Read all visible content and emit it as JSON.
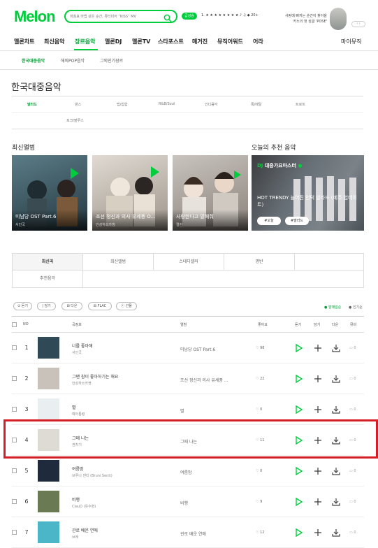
{
  "header": {
    "logo": "Melon",
    "search_placeholder": "마침표 마법 같은 순간, 뮤터미어 “KISS” MV",
    "badge": "급상승",
    "rank": "1. ★ ★ ★ ★ ★ ★ ★ ★ ♪ ♫ ◆ 20+",
    "promo_line1": "사랑에 빠지는 순간이 찾아올",
    "promo_line2": "카노의 첫 싱글 'POSE'",
    "arrows": "‹ ›"
  },
  "gnb": [
    "멜론차트",
    "최신음악",
    "장르음악",
    "멜론DJ",
    "멜론TV",
    "스타포스트",
    "매거진",
    "뮤직어워드",
    "어라",
    "마이뮤직"
  ],
  "subnav": [
    "한국대중음악",
    "해외POP음악",
    "그외인기장르"
  ],
  "page_title": "한국대중음악",
  "genres": [
    "발라드",
    "댄스",
    "랩/힙합",
    "R&B/Soul",
    "인디음악",
    "록/메탈",
    "트로트",
    "포크/블루스"
  ],
  "sections": {
    "latest_albums": "최신앨범",
    "today_rec": "오늘의 추천 음악"
  },
  "albums": [
    {
      "title": "미남당 OST Part.6",
      "artist": "서인국",
      "bg": "#2f4a56"
    },
    {
      "title": "조선 정신과 의사 유세풍 O...",
      "artist": "안성하쓰카쟁",
      "bg": "#c8c2bb"
    },
    {
      "title": "사랑한다고 말해줘",
      "artist": "컬린",
      "bg": "#a59e97"
    }
  ],
  "dj": {
    "head": "DJ",
    "name": "대중가요마스터",
    "body": "HOT TRENDY 늘어진 언덕 발라드 (예주 업데이트)",
    "tag1": "#오늘",
    "tag2": "#발라드"
  },
  "tabs": [
    "최신곡",
    "최신앨범",
    "스테디셀러",
    "명반",
    "추천음악"
  ],
  "action_buttons": [
    "⊙ 듣기",
    "| 담기",
    "⊞ 다운",
    "⊞ FLAC",
    "ⓣ 선물"
  ],
  "sort": {
    "latest": "● 발매일순",
    "popular": "● 인기순"
  },
  "table_headers": {
    "no": "NO",
    "song": "곡정보",
    "album": "앨범",
    "like": "좋아요",
    "play": "듣기",
    "add": "담기",
    "download": "다운",
    "mv": "뮤비"
  },
  "songs": [
    {
      "no": "1",
      "title": "너를 좋아해",
      "artist": "서인국",
      "album": "미남당 OST Part.6",
      "likes": "♡ 98",
      "mv": "▭ 0",
      "thumb": "#2f4a56"
    },
    {
      "no": "2",
      "title": "그땐 참이 좋아하기는 해요",
      "artist": "안성하쓰카쟁",
      "album": "조선 정신과 의사 유세풍 ...",
      "likes": "♡ 22",
      "mv": "▭ 0",
      "thumb": "#c8c2bb"
    },
    {
      "no": "3",
      "title": "별",
      "artist": "예아통령",
      "album": "별",
      "likes": "♡ 0",
      "mv": "▭ 0",
      "thumb": "#e9eef1"
    },
    {
      "no": "4",
      "title": "그때 나는",
      "artist": "권차기",
      "album": "그때 나는",
      "likes": "♡ 11",
      "mv": "▭ 0",
      "thumb": "#dedbd4"
    },
    {
      "no": "5",
      "title": "여름밤",
      "artist": "브루니 센티 (Bruni Senti)",
      "album": "여름밤",
      "likes": "♡ 0",
      "mv": "▭ 0",
      "thumb": "#1f2b3c"
    },
    {
      "no": "6",
      "title": "비행",
      "artist": "ClauD (유수현)",
      "album": "비행",
      "likes": "♡ 9",
      "mv": "▭ 0",
      "thumb": "#6a7a52"
    },
    {
      "no": "7",
      "title": "관로 배운 연애",
      "artist": "브레",
      "album": "관로 배운 연애",
      "likes": "♡ 12",
      "mv": "▭ 0",
      "thumb": "#4bb6c8"
    }
  ],
  "colors": {
    "brand": "#00cd3c",
    "highlight": "#d71d25"
  }
}
